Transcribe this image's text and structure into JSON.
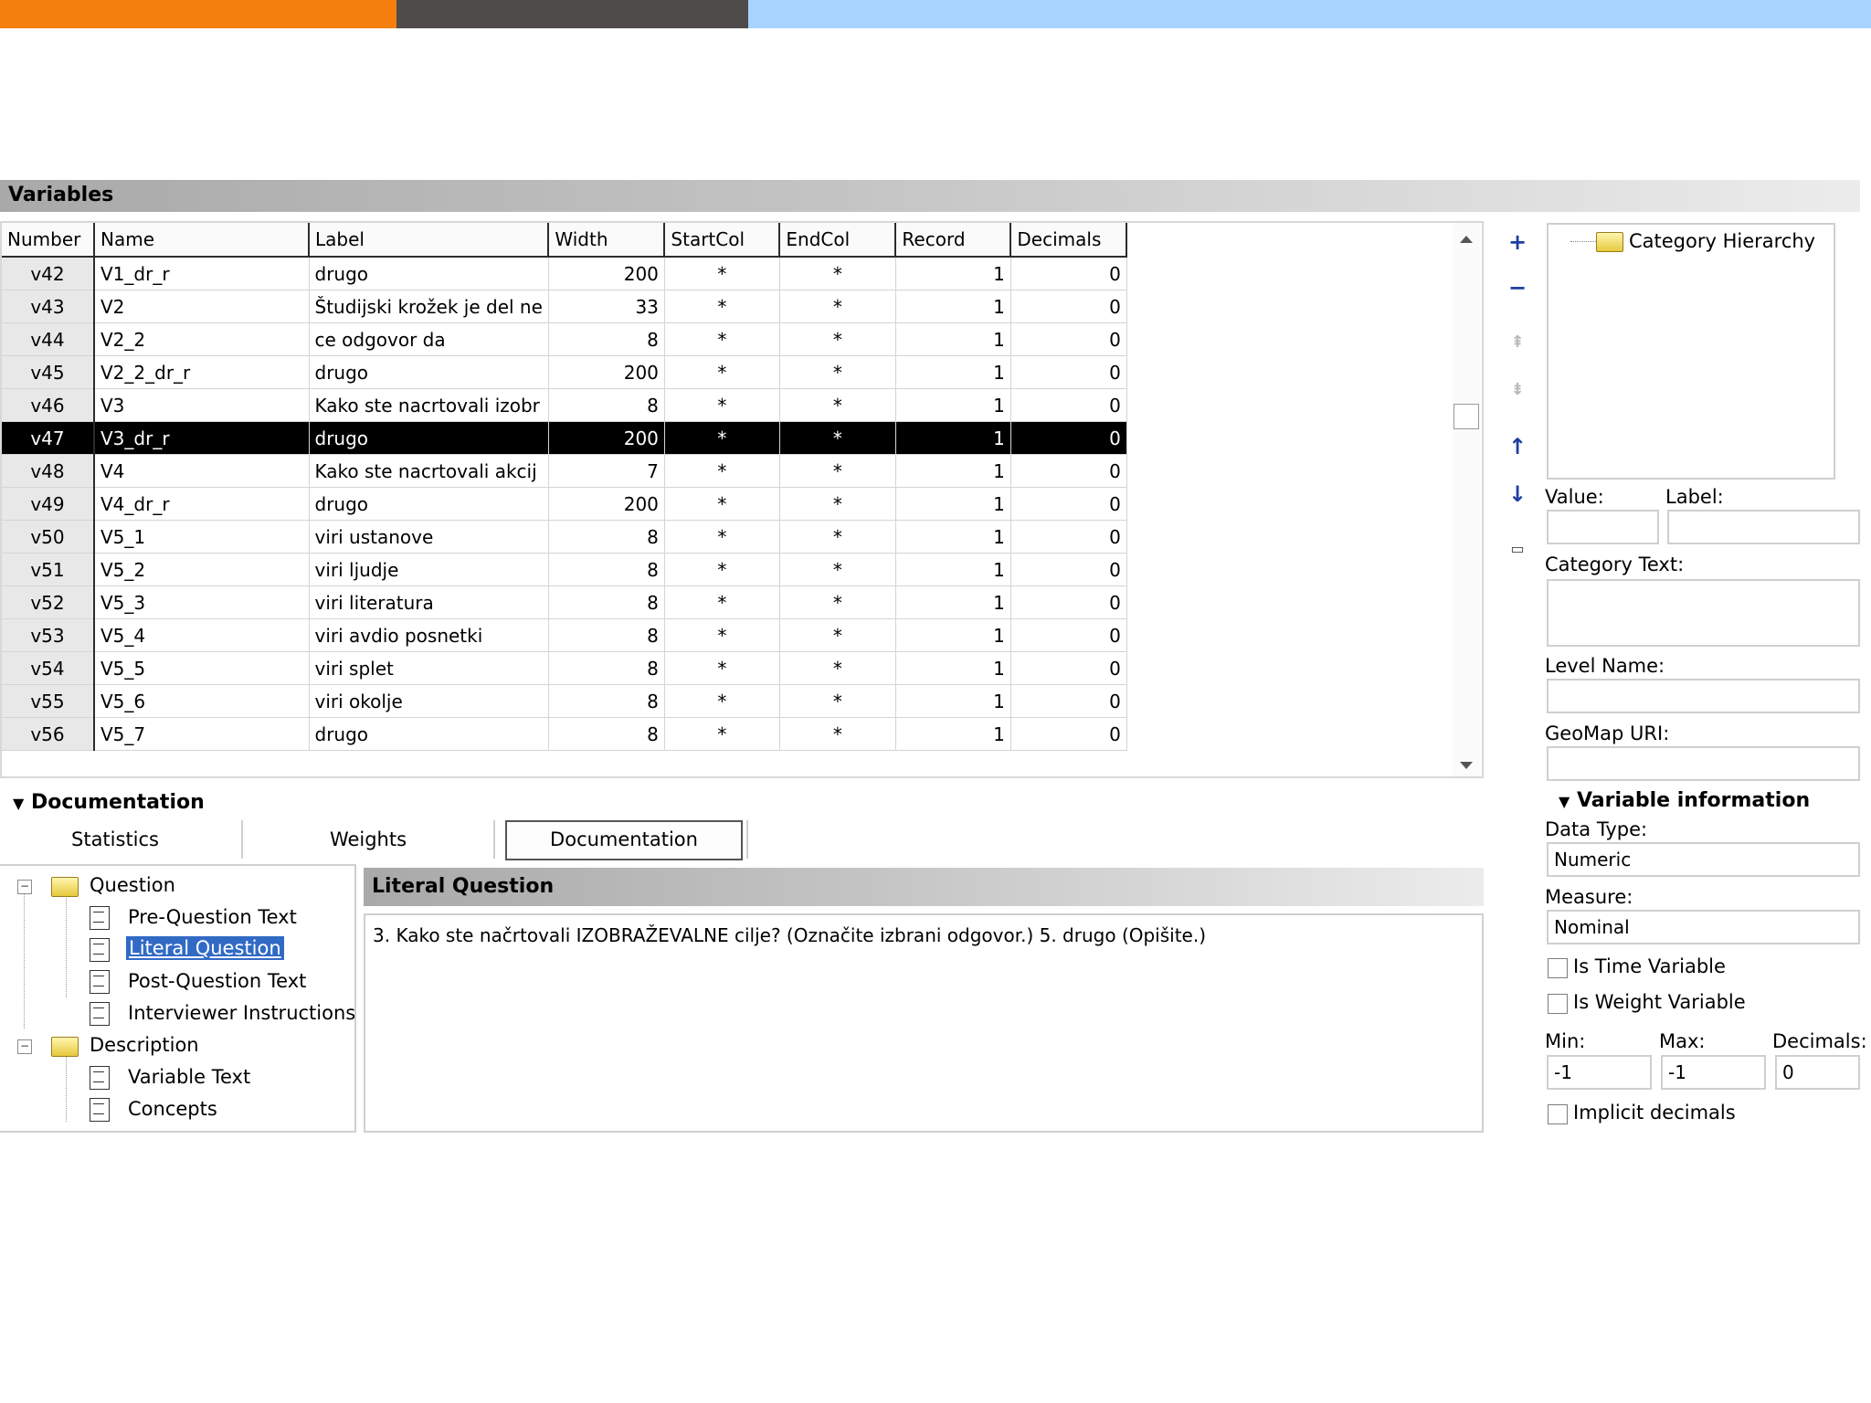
{
  "colors": {
    "bar_orange": "#f47f0c",
    "bar_dark": "#4f4b4b",
    "bar_blue": "#a8d3ff",
    "selection": "#000000",
    "link_highlight": "#316ac5"
  },
  "variables_section": {
    "title": "Variables"
  },
  "table": {
    "headers": [
      "Number",
      "Name",
      "Label",
      "Width",
      "StartCol",
      "EndCol",
      "Record",
      "Decimals"
    ],
    "rows": [
      [
        "v42",
        "V1_dr_r",
        "drugo",
        "200",
        "*",
        "*",
        "1",
        "0"
      ],
      [
        "v43",
        "V2",
        "Študijski krožek je del ne",
        "33",
        "*",
        "*",
        "1",
        "0"
      ],
      [
        "v44",
        "V2_2",
        "ce odgovor da",
        "8",
        "*",
        "*",
        "1",
        "0"
      ],
      [
        "v45",
        "V2_2_dr_r",
        "drugo",
        "200",
        "*",
        "*",
        "1",
        "0"
      ],
      [
        "v46",
        "V3",
        "Kako ste nacrtovali izobr",
        "8",
        "*",
        "*",
        "1",
        "0"
      ],
      [
        "v47",
        "V3_dr_r",
        "drugo",
        "200",
        "*",
        "*",
        "1",
        "0"
      ],
      [
        "v48",
        "V4",
        "Kako ste nacrtovali akcij",
        "7",
        "*",
        "*",
        "1",
        "0"
      ],
      [
        "v49",
        "V4_dr_r",
        "drugo",
        "200",
        "*",
        "*",
        "1",
        "0"
      ],
      [
        "v50",
        "V5_1",
        "viri ustanove",
        "8",
        "*",
        "*",
        "1",
        "0"
      ],
      [
        "v51",
        "V5_2",
        "viri ljudje",
        "8",
        "*",
        "*",
        "1",
        "0"
      ],
      [
        "v52",
        "V5_3",
        "viri literatura",
        "8",
        "*",
        "*",
        "1",
        "0"
      ],
      [
        "v53",
        "V5_4",
        "viri avdio posnetki",
        "8",
        "*",
        "*",
        "1",
        "0"
      ],
      [
        "v54",
        "V5_5",
        "viri splet",
        "8",
        "*",
        "*",
        "1",
        "0"
      ],
      [
        "v55",
        "V5_6",
        "viri okolje",
        "8",
        "*",
        "*",
        "1",
        "0"
      ],
      [
        "v56",
        "V5_7",
        "drugo",
        "8",
        "*",
        "*",
        "1",
        "0"
      ]
    ],
    "selected_row": "v47"
  },
  "category_panel": {
    "tree_root": "Category Hierarchy",
    "value_label": "Value:",
    "label_label": "Label:",
    "category_text_label": "Category Text:",
    "level_name_label": "Level Name:",
    "geomap_label": "GeoMap URI:"
  },
  "variable_info": {
    "title": "Variable information",
    "data_type_label": "Data Type:",
    "data_type_value": "Numeric",
    "measure_label": "Measure:",
    "measure_value": "Nominal",
    "is_time_label": "Is Time Variable",
    "is_weight_label": "Is Weight Variable",
    "min_label": "Min:",
    "max_label": "Max:",
    "decimals_label": "Decimals:",
    "min_value": "-1",
    "max_value": "-1",
    "decimals_value": "0",
    "implicit_label": "Implicit decimals"
  },
  "documentation": {
    "title": "Documentation",
    "tabs": [
      "Statistics",
      "Weights",
      "Documentation"
    ],
    "active_tab": "Documentation",
    "tree": {
      "question": "Question",
      "pre_question": "Pre-Question Text",
      "literal_question": "Literal Question",
      "post_question": "Post-Question Text",
      "interviewer": "Interviewer Instructions",
      "description": "Description",
      "variable_text": "Variable Text",
      "concepts": "Concepts"
    },
    "detail_title": "Literal Question",
    "detail_text": "3. Kako ste načrtovali IZOBRAŽEVALNE cilje? (Označite izbrani odgovor.) 5. drugo (Opišite.)"
  }
}
